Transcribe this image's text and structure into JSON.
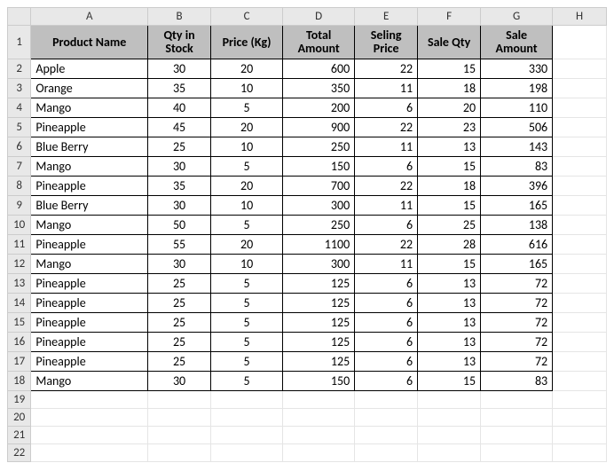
{
  "columns": [
    "A",
    "B",
    "C",
    "D",
    "E",
    "F",
    "G",
    "H"
  ],
  "headers": {
    "product_name": "Product Name",
    "qty_stock": "Qty in Stock",
    "price": "Price (Kg)",
    "total_amount": "Total Amount",
    "selling_price": "Seling Price",
    "sale_qty": "Sale Qty",
    "sale_amount": "Sale Amount"
  },
  "rows": [
    {
      "n": "2",
      "name": "Apple",
      "qty": "30",
      "price": "20",
      "total": "600",
      "sell": "22",
      "sqty": "15",
      "samt": "330"
    },
    {
      "n": "3",
      "name": "Orange",
      "qty": "35",
      "price": "10",
      "total": "350",
      "sell": "11",
      "sqty": "18",
      "samt": "198"
    },
    {
      "n": "4",
      "name": "Mango",
      "qty": "40",
      "price": "5",
      "total": "200",
      "sell": "6",
      "sqty": "20",
      "samt": "110"
    },
    {
      "n": "5",
      "name": "Pineapple",
      "qty": "45",
      "price": "20",
      "total": "900",
      "sell": "22",
      "sqty": "23",
      "samt": "506"
    },
    {
      "n": "6",
      "name": "Blue Berry",
      "qty": "25",
      "price": "10",
      "total": "250",
      "sell": "11",
      "sqty": "13",
      "samt": "143"
    },
    {
      "n": "7",
      "name": "Mango",
      "qty": "30",
      "price": "5",
      "total": "150",
      "sell": "6",
      "sqty": "15",
      "samt": "83"
    },
    {
      "n": "8",
      "name": "Pineapple",
      "qty": "35",
      "price": "20",
      "total": "700",
      "sell": "22",
      "sqty": "18",
      "samt": "396"
    },
    {
      "n": "9",
      "name": "Blue Berry",
      "qty": "30",
      "price": "10",
      "total": "300",
      "sell": "11",
      "sqty": "15",
      "samt": "165"
    },
    {
      "n": "10",
      "name": "Mango",
      "qty": "50",
      "price": "5",
      "total": "250",
      "sell": "6",
      "sqty": "25",
      "samt": "138"
    },
    {
      "n": "11",
      "name": "Pineapple",
      "qty": "55",
      "price": "20",
      "total": "1100",
      "sell": "22",
      "sqty": "28",
      "samt": "616"
    },
    {
      "n": "12",
      "name": "Mango",
      "qty": "30",
      "price": "10",
      "total": "300",
      "sell": "11",
      "sqty": "15",
      "samt": "165"
    },
    {
      "n": "13",
      "name": "Pineapple",
      "qty": "25",
      "price": "5",
      "total": "125",
      "sell": "6",
      "sqty": "13",
      "samt": "72"
    },
    {
      "n": "14",
      "name": "Pineapple",
      "qty": "25",
      "price": "5",
      "total": "125",
      "sell": "6",
      "sqty": "13",
      "samt": "72"
    },
    {
      "n": "15",
      "name": "Pineapple",
      "qty": "25",
      "price": "5",
      "total": "125",
      "sell": "6",
      "sqty": "13",
      "samt": "72"
    },
    {
      "n": "16",
      "name": "Pineapple",
      "qty": "25",
      "price": "5",
      "total": "125",
      "sell": "6",
      "sqty": "13",
      "samt": "72"
    },
    {
      "n": "17",
      "name": "Pineapple",
      "qty": "25",
      "price": "5",
      "total": "125",
      "sell": "6",
      "sqty": "13",
      "samt": "72"
    },
    {
      "n": "18",
      "name": "Mango",
      "qty": "30",
      "price": "5",
      "total": "150",
      "sell": "6",
      "sqty": "15",
      "samt": "83"
    }
  ],
  "empty_rows": [
    "19",
    "20",
    "21",
    "22"
  ]
}
